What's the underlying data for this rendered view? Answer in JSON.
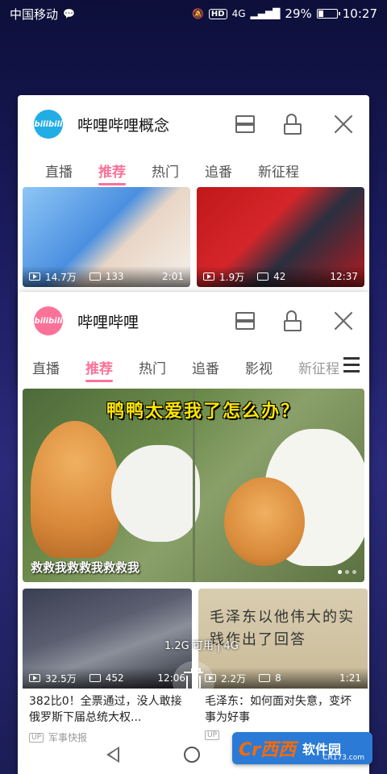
{
  "status_bar": {
    "carrier": "中国移动",
    "net_label": "4G",
    "hd_label": "HD",
    "battery": "29%",
    "battery_level": 0.29,
    "time": "10:27",
    "icons": [
      "chat-icon",
      "mute-icon",
      "hd-icon",
      "signal-icon",
      "battery-icon"
    ]
  },
  "back_card": {
    "app_title": "哔哩哔哩概念",
    "logo_text": "bilibili",
    "tabs": [
      "直播",
      "推荐",
      "热门",
      "追番",
      "新征程"
    ],
    "active_tab": 1,
    "videos": [
      {
        "views": "14.7万",
        "danmaku": "133",
        "duration": "2:01"
      },
      {
        "views": "1.9万",
        "danmaku": "42",
        "duration": "12:37"
      }
    ]
  },
  "front_card": {
    "app_title": "哔哩哔哩",
    "logo_text": "bilibili",
    "tabs": [
      "直播",
      "推荐",
      "热门",
      "追番",
      "影视",
      "新征程"
    ],
    "active_tab": 1,
    "banner": {
      "headline": "鸭鸭太爱我了怎么办？",
      "caption": "救救我救救我救救我"
    },
    "videos": [
      {
        "views": "32.5万",
        "danmaku": "452",
        "duration": "12:06",
        "title": "382比0！全票通过，没人敢接俄罗斯下届总统大权...",
        "up_badge": "UP",
        "uploader": "军事快报"
      },
      {
        "views": "2.2万",
        "danmaku": "8",
        "duration": "1:21",
        "title": "毛泽东：如何面对失意，变坏事为好事",
        "thumb_text": "毛泽东以他伟大的实践作出了回答",
        "up_badge": "UP",
        "uploader": ""
      }
    ]
  },
  "overlay": {
    "memory_text": "1.2G 可用 | 4G"
  },
  "watermark": {
    "logo": "Cr西西",
    "name": "软件园",
    "url": "CR173.com"
  },
  "colors": {
    "accent": "#fb7299",
    "bilibili_blue": "#23ade5",
    "watermark_blue": "#2b7bd6"
  }
}
